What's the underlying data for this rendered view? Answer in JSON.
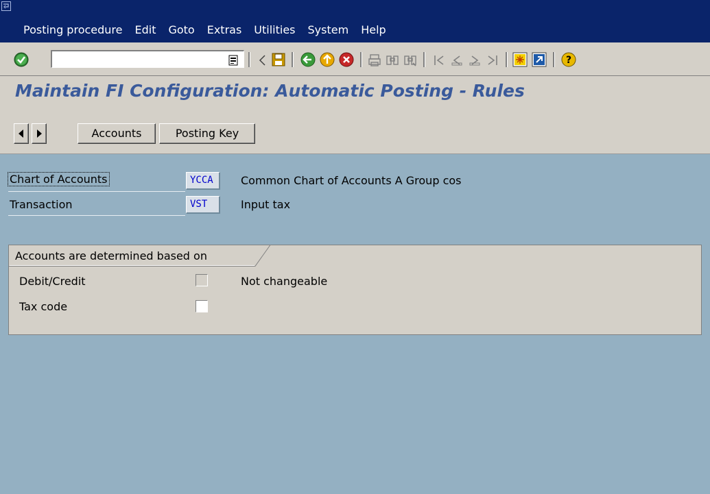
{
  "menu": {
    "items": [
      "Posting procedure",
      "Edit",
      "Goto",
      "Extras",
      "Utilities",
      "System",
      "Help"
    ]
  },
  "toolbar": {
    "command_value": "",
    "icons": [
      "enter-icon",
      "command-history-icon",
      "back-arrow-icon",
      "save-icon",
      "back-icon",
      "exit-icon",
      "cancel-icon",
      "print-icon",
      "find-icon",
      "find-next-icon",
      "first-page-icon",
      "previous-page-icon",
      "next-page-icon",
      "last-page-icon",
      "create-session-icon",
      "shortcut-icon",
      "help-icon"
    ]
  },
  "title": "Maintain FI Configuration: Automatic Posting - Rules",
  "app_toolbar": {
    "accounts_label": "Accounts",
    "posting_key_label": "Posting Key"
  },
  "fields": {
    "chart_of_accounts": {
      "label": "Chart of Accounts",
      "value": "YCCA",
      "description": "Common Chart of Accounts A Group cos"
    },
    "transaction": {
      "label": "Transaction",
      "value": "VST",
      "description": "Input tax"
    }
  },
  "group": {
    "title": "Accounts are determined based on",
    "debit_credit": {
      "label": "Debit/Credit",
      "checked": false,
      "note": "Not changeable"
    },
    "tax_code": {
      "label": "Tax code",
      "checked": false
    }
  },
  "colors": {
    "menubar": "#0a246a",
    "background": "#94b0c2",
    "title_text": "#3a5a9b",
    "field_value_text": "#0000cc"
  }
}
